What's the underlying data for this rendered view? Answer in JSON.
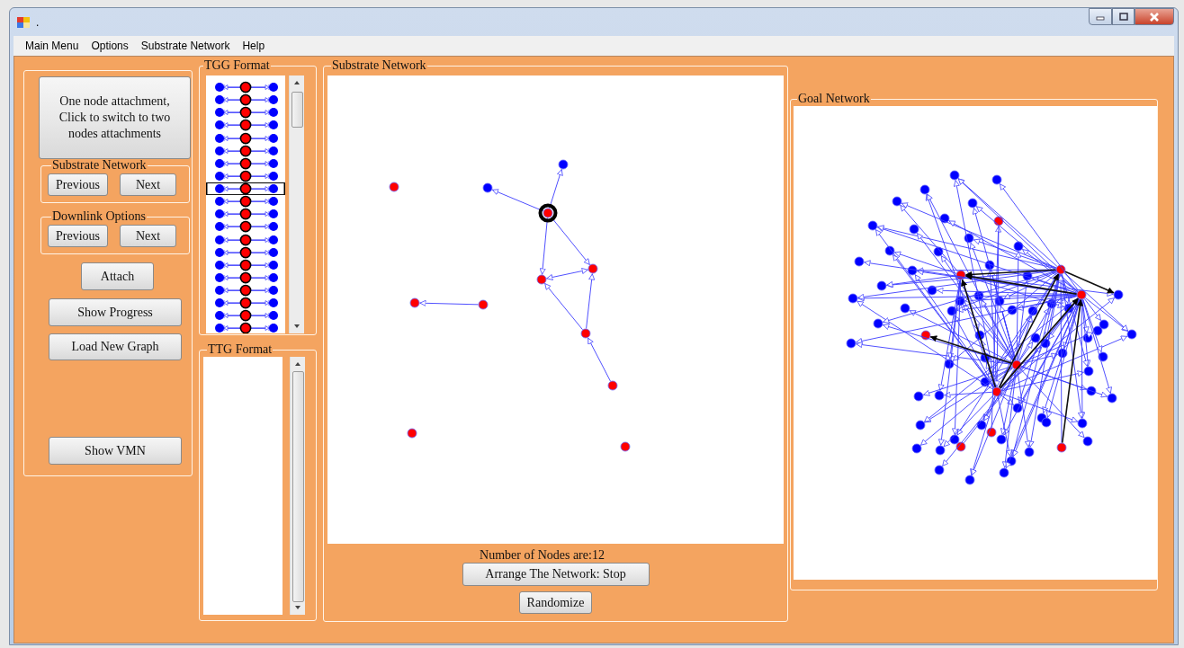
{
  "window": {
    "title": "."
  },
  "menu": [
    "Main Menu",
    "Options",
    "Substrate Network",
    "Help"
  ],
  "left_panel": {
    "mode_button": "One node attachment, Click to switch to two nodes attachments",
    "substrate_network": {
      "title": "Substrate Network",
      "buttons": [
        "Previous",
        "Next"
      ]
    },
    "downlink_options": {
      "title": "Downlink Options",
      "buttons": [
        "Previous",
        "Next"
      ]
    },
    "buttons": [
      "Attach",
      "Show Progress",
      "Load New Graph"
    ],
    "bottom_button": "Show VMN"
  },
  "tgg_format": {
    "title": "TGG Format",
    "items": [
      {
        "selected": false
      },
      {
        "selected": false
      },
      {
        "selected": false
      },
      {
        "selected": false
      },
      {
        "selected": false
      },
      {
        "selected": false
      },
      {
        "selected": false
      },
      {
        "selected": false
      },
      {
        "selected": true
      },
      {
        "selected": false
      },
      {
        "selected": false
      },
      {
        "selected": false
      },
      {
        "selected": false
      },
      {
        "selected": false
      },
      {
        "selected": false
      },
      {
        "selected": false
      },
      {
        "selected": false
      },
      {
        "selected": false
      },
      {
        "selected": false
      },
      {
        "selected": false
      }
    ]
  },
  "ttg_format": {
    "title": "TTG Format"
  },
  "substrate_network": {
    "title": "Substrate Network",
    "node_count": "Number of Nodes are:12",
    "buttons": [
      "Arrange The Network: Stop",
      "Randomize"
    ]
  },
  "goal_network": {
    "title": "Goal Network"
  }
}
